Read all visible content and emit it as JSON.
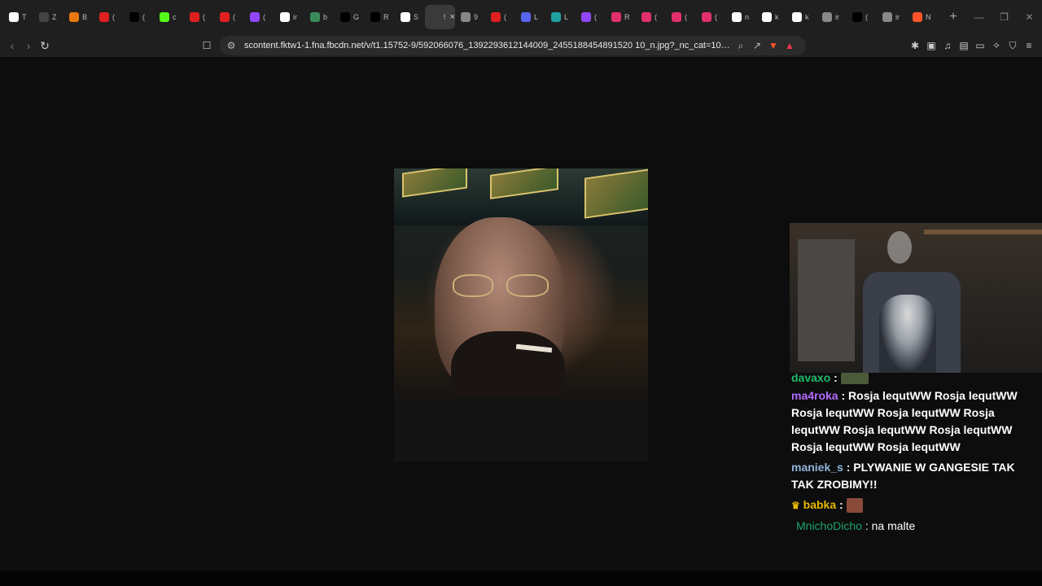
{
  "browser": {
    "tabs": [
      {
        "label": "T",
        "icon": "brave-icon",
        "color": "#ffffff"
      },
      {
        "label": "Z",
        "icon": "blank-icon",
        "color": "#444444"
      },
      {
        "label": "B",
        "icon": "orange-icon",
        "color": "#e8790a"
      },
      {
        "label": "(",
        "icon": "youtube-icon",
        "color": "#e02020"
      },
      {
        "label": "(",
        "icon": "x-icon",
        "color": "#000000"
      },
      {
        "label": "c",
        "icon": "kick-icon",
        "color": "#53fc18"
      },
      {
        "label": "(",
        "icon": "youtube-icon",
        "color": "#e02020"
      },
      {
        "label": "(",
        "icon": "youtube-icon",
        "color": "#e02020"
      },
      {
        "label": "(",
        "icon": "twitch-icon",
        "color": "#9146ff"
      },
      {
        "label": "ir",
        "icon": "google-icon",
        "color": "#ffffff"
      },
      {
        "label": "b",
        "icon": "gemini-icon",
        "color": "#3a8a5a"
      },
      {
        "label": "G",
        "icon": "x-icon",
        "color": "#000000"
      },
      {
        "label": "R",
        "icon": "x-icon",
        "color": "#000000"
      },
      {
        "label": "S",
        "icon": "doc-icon",
        "color": "#ffffff"
      },
      {
        "label": "5",
        "icon": "none",
        "color": "#3a3a3a",
        "active": true
      },
      {
        "label": "9",
        "icon": "globe-icon",
        "color": "#888888"
      },
      {
        "label": "(",
        "icon": "youtube-icon",
        "color": "#e02020"
      },
      {
        "label": "L",
        "icon": "discord-icon",
        "color": "#5865f2"
      },
      {
        "label": "L",
        "icon": "loading-icon",
        "color": "#20a0a0"
      },
      {
        "label": "(",
        "icon": "twitch-icon",
        "color": "#9146ff"
      },
      {
        "label": "R",
        "icon": "instagram-icon",
        "color": "#e1306c"
      },
      {
        "label": "(",
        "icon": "instagram-icon",
        "color": "#e1306c"
      },
      {
        "label": "(",
        "icon": "instagram-icon",
        "color": "#e1306c"
      },
      {
        "label": "(",
        "icon": "instagram-icon",
        "color": "#e1306c"
      },
      {
        "label": "n",
        "icon": "google-icon",
        "color": "#ffffff"
      },
      {
        "label": "k",
        "icon": "google-icon",
        "color": "#ffffff"
      },
      {
        "label": "k",
        "icon": "google-icon",
        "color": "#ffffff"
      },
      {
        "label": "ir",
        "icon": "globe-icon",
        "color": "#888888"
      },
      {
        "label": "(",
        "icon": "x-icon",
        "color": "#000000"
      },
      {
        "label": "ir",
        "icon": "globe-icon",
        "color": "#888888"
      },
      {
        "label": "N",
        "icon": "brave-icon",
        "color": "#fb542b"
      }
    ],
    "url": "scontent.fktw1-1.fna.fbcdn.net/v/t1.15752-9/592066076_1392293612144009_2455188454891520 10_n.jpg?_nc_cat=104&ccb=1-7&_nc_sid=9f8...",
    "close_label": "×",
    "new_tab_label": "+"
  },
  "chat": {
    "messages": [
      {
        "user": "davaxo",
        "sep": " : ",
        "text": "",
        "user_color": "#1ebc6c",
        "emote": true
      },
      {
        "user": "ma4roka",
        "sep": " : ",
        "text": "Rosja lequtWW Rosja lequtWW Rosja lequtWW Rosja lequtWW Rosja lequtWW Rosja lequtWW Rosja lequtWW Rosja lequtWW Rosja lequtWW",
        "user_color": "#b36bff"
      },
      {
        "user": "maniek_s",
        "sep": " : ",
        "text": "PLYWANIE W GANGESIE TAK TAK ZROBIMY!!",
        "user_color": "#8fb3d9"
      },
      {
        "user": "babka",
        "sep": " : ",
        "text": "",
        "user_color": "#e6b800",
        "emote": true
      },
      {
        "user": "MnichoDicho",
        "sep": " : ",
        "text": "na malte",
        "user_color": "#1fa36b"
      }
    ]
  }
}
